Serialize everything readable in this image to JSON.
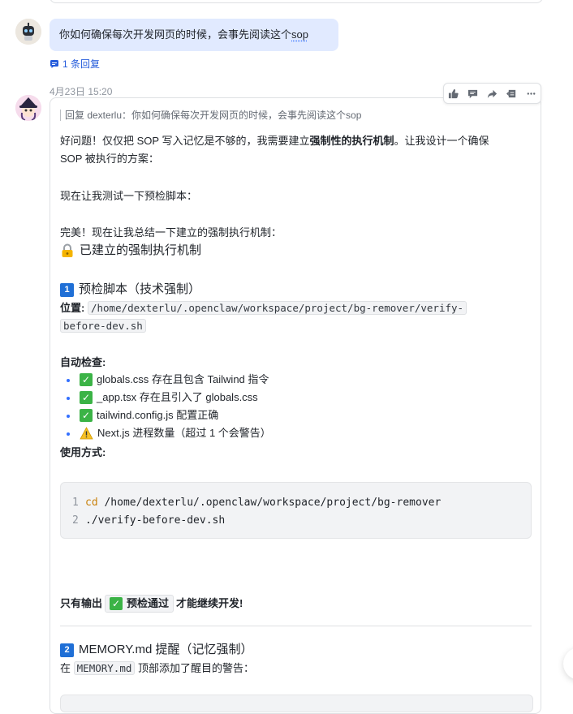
{
  "prev_message": {},
  "user_message": {
    "text_before": "你如何确保每次开发网页的时候，会事先阅读这个",
    "text_link": "sop",
    "reply_count": "1 条回复"
  },
  "bot_message": {
    "timestamp": "4月23日 15:20",
    "toolbar": [
      "like-icon",
      "comment-icon",
      "forward-icon",
      "quote-icon",
      "more-icon"
    ],
    "quote": "回复 dexterlu：你如何确保每次开发网页的时候，会事先阅读这个sop",
    "intro_1a": "好问题！仅仅把 SOP 写入记忆是不够的，我需要建立",
    "intro_1b": "强制性的执行机制",
    "intro_1c": "。让我设计一个确保",
    "intro_2": "SOP 被执行的方案：",
    "test_line": "现在让我测试一下预检脚本：",
    "summary_line": "完美！现在让我总结一下建立的强制执行机制：",
    "mech_title": "已建立的强制执行机制",
    "section1": {
      "num": "1",
      "title": "预检脚本（技术强制）",
      "location_label": "位置",
      "location_sep": ":",
      "path_1": "/home/dexterlu/.openclaw/workspace/project/bg-remover/verify-",
      "path_2": "before-dev.sh",
      "auto_check": "自动检查",
      "checks": [
        {
          "icon": "check",
          "text": "globals.css 存在且包含 Tailwind 指令"
        },
        {
          "icon": "check",
          "text": "_app.tsx 存在且引入了 globals.css"
        },
        {
          "icon": "check",
          "text": "tailwind.config.js 配置正确"
        },
        {
          "icon": "warning",
          "text": "Next.js 进程数量（超过 1 个会警告）"
        }
      ],
      "usage": "使用方式",
      "colon": ":",
      "code": [
        {
          "ln": "1",
          "kw": "cd",
          "rest": " /home/dexterlu/.openclaw/workspace/project/bg-remover"
        },
        {
          "ln": "2",
          "kw": "",
          "rest": "./verify-before-dev.sh"
        }
      ],
      "only_output": "只有输出",
      "pass_badge": "预检通过",
      "continue_dev": "才能继续开发!"
    },
    "section2": {
      "num": "2",
      "title": "MEMORY.md 提醒（记忆强制）",
      "line_a": "在",
      "file": "MEMORY.md",
      "line_b": "顶部添加了醒目的警告："
    }
  },
  "colors": {
    "bubble": "#e1eaff",
    "link": "#245bdb",
    "number_badge": "#1f6fd6",
    "check_green": "#3bb346",
    "keyword": "#c9820d"
  }
}
